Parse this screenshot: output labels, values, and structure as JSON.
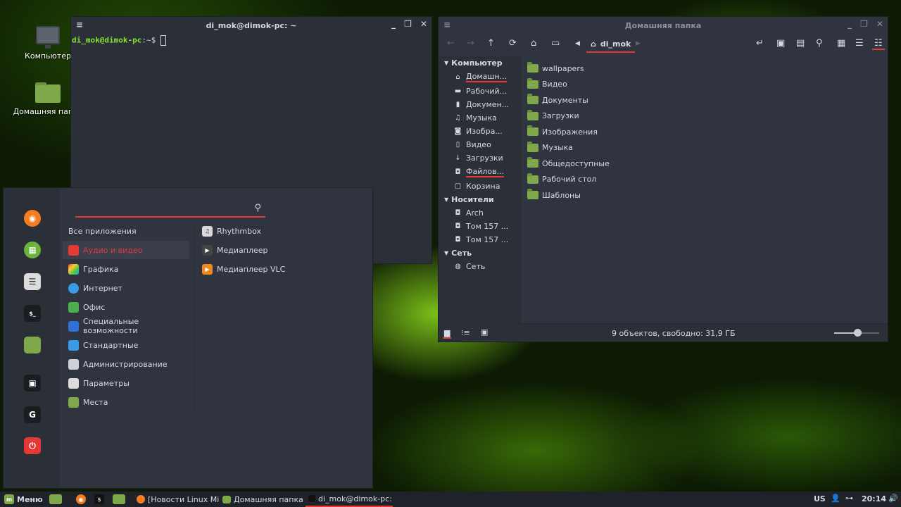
{
  "desktop": {
    "icons": [
      {
        "label": "Компьютер"
      },
      {
        "label": "Домашняя папка"
      }
    ]
  },
  "terminal": {
    "title": "di_mok@dimok-pc: ~",
    "prompt_user": "di_mok@dimok-pc",
    "prompt_path": ":~$"
  },
  "file_manager": {
    "title": "Домашняя папка",
    "location": "di_mok",
    "sidebar": {
      "computer_header": "Компьютер",
      "computer_items": [
        "Домашн...",
        "Рабочий...",
        "Докумен...",
        "Музыка",
        "Изобра...",
        "Видео",
        "Загрузки",
        "Файлов...",
        "Корзина"
      ],
      "devices_header": "Носители",
      "devices_items": [
        "Arch",
        "Том 157 ...",
        "Том 157 ..."
      ],
      "network_header": "Сеть",
      "network_items": [
        "Сеть"
      ]
    },
    "files": [
      "wallpapers",
      "Видео",
      "Документы",
      "Загрузки",
      "Изображения",
      "Музыка",
      "Общедоступные",
      "Рабочий стол",
      "Шаблоны"
    ],
    "status_text": "9 объектов, свободно: 31,9 ГБ"
  },
  "menu": {
    "search_placeholder": "",
    "categories": [
      "Все приложения",
      "Аудио и видео",
      "Графика",
      "Интернет",
      "Офис",
      "Специальные возможности",
      "Стандартные",
      "Администрирование",
      "Параметры",
      "Места"
    ],
    "apps": [
      "Rhythmbox",
      "Медиаплеер",
      "Медиаплеер VLC"
    ],
    "colors": {
      "accent": "#e53935",
      "bg": "#2f343f"
    }
  },
  "panel": {
    "menu_label": "Меню",
    "tasks": [
      "[Новости Linux Min...",
      "Домашняя папка",
      "di_mok@dimok-pc: ~"
    ],
    "keyboard_layout": "US",
    "clock": "20:14"
  }
}
